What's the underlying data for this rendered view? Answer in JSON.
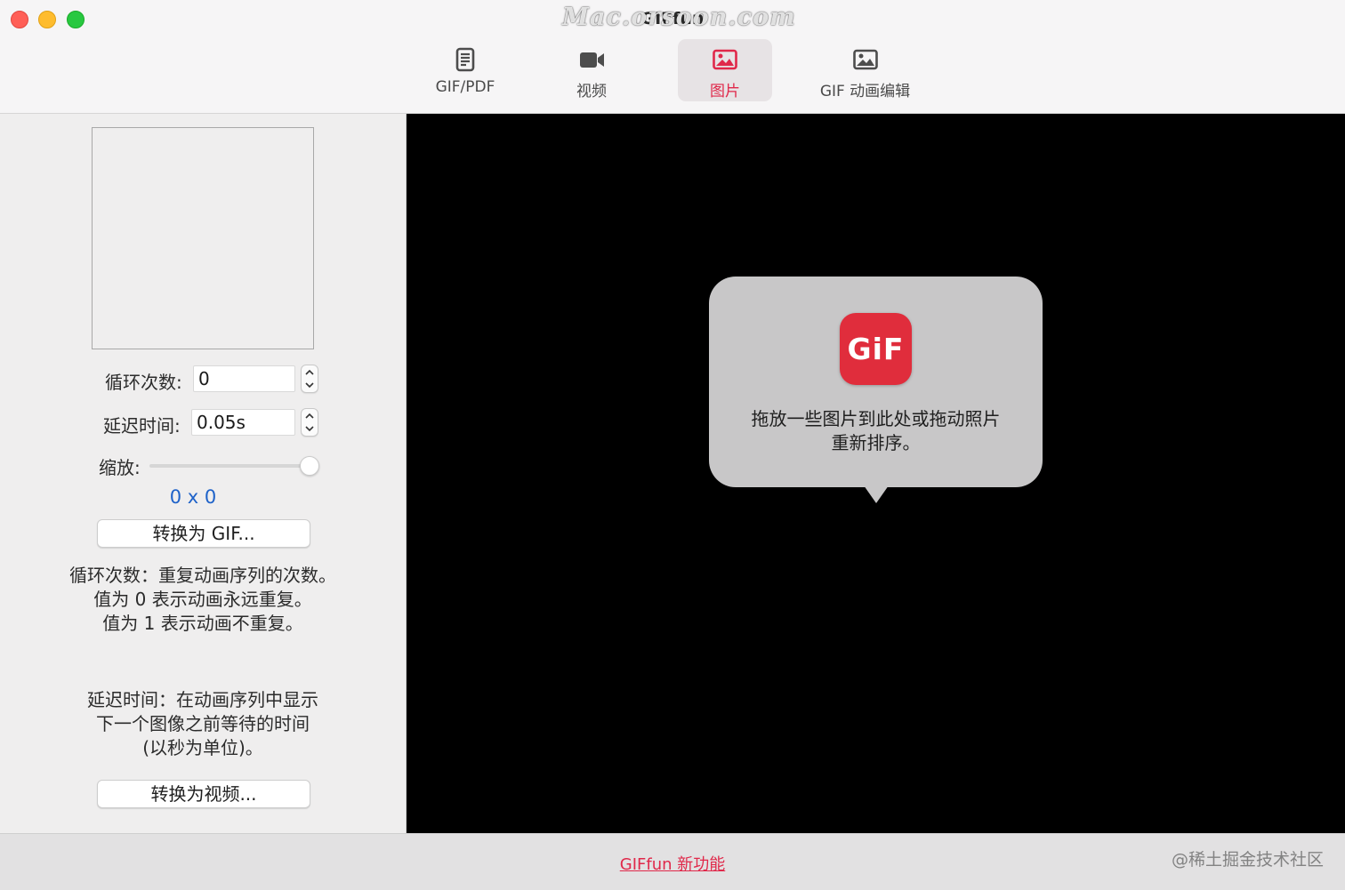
{
  "window": {
    "title": "GIFfun",
    "watermark": "Mac.orsoon.com"
  },
  "toolbar": {
    "tabs": [
      {
        "label": "GIF/PDF",
        "icon": "document-icon",
        "selected": false
      },
      {
        "label": "视频",
        "icon": "video-camera-icon",
        "selected": false
      },
      {
        "label": "图片",
        "icon": "picture-icon",
        "selected": true
      },
      {
        "label": "GIF 动画编辑",
        "icon": "picture-icon",
        "selected": false
      }
    ],
    "accent_color": "#e0284a"
  },
  "sidebar": {
    "loop_label": "循环次数:",
    "loop_value": "0",
    "delay_label": "延迟时间:",
    "delay_value": "0.05s",
    "zoom_label": "缩放:",
    "zoom_level": 1.0,
    "dimensions": "0 x 0",
    "convert_gif_label": "转换为 GIF...",
    "loop_help": [
      "循环次数：重复动画序列的次数。",
      "值为 0 表示动画永远重复。",
      "值为 1 表示动画不重复。"
    ],
    "delay_help": [
      "延迟时间：在动画序列中显示",
      "下一个图像之前等待的时间",
      "(以秒为单位)。"
    ],
    "convert_video_label": "转换为视频..."
  },
  "drop_area": {
    "icon_text": "GiF",
    "instructions": [
      "拖放一些图片到此处或拖动照片",
      "重新排序。"
    ]
  },
  "footer": {
    "whats_new_link": "GIFfun 新功能",
    "watermark": "@稀土掘金技术社区"
  }
}
